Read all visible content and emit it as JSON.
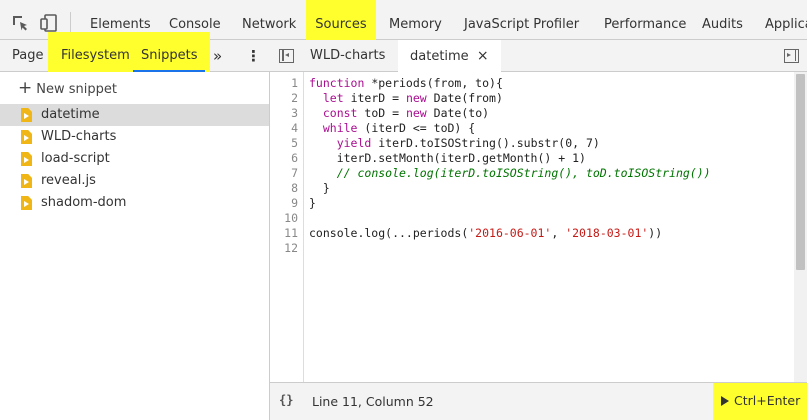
{
  "top_tabs": [
    {
      "label": "Elements"
    },
    {
      "label": "Console"
    },
    {
      "label": "Network"
    },
    {
      "label": "Sources"
    },
    {
      "label": "Memory"
    },
    {
      "label": "JavaScript Profiler"
    },
    {
      "label": "Performance"
    },
    {
      "label": "Audits"
    },
    {
      "label": "Applica"
    }
  ],
  "nav": {
    "tabs": [
      {
        "label": "Page"
      },
      {
        "label": "Filesystem"
      },
      {
        "label": "Snippets"
      }
    ],
    "more_glyph": "»",
    "menu_glyph": "⋮",
    "new_snippet_label": "New snippet",
    "files": [
      {
        "name": "datetime",
        "selected": true
      },
      {
        "name": "WLD-charts"
      },
      {
        "name": "load-script"
      },
      {
        "name": "reveal.js"
      },
      {
        "name": "shadom-dom"
      }
    ]
  },
  "editor": {
    "tabs": [
      {
        "label": "WLD-charts"
      },
      {
        "label": "datetime",
        "close_glyph": "×"
      }
    ],
    "line_numbers": [
      "1",
      "2",
      "3",
      "4",
      "5",
      "6",
      "7",
      "8",
      "9",
      "10",
      "11",
      "12"
    ],
    "code_lines": [
      "function *periods(from, to){",
      "  let iterD = new Date(from)",
      "  const toD = new Date(to)",
      "  while (iterD <= toD) {",
      "    yield iterD.toISOString().substr(0, 7)",
      "    iterD.setMonth(iterD.getMonth() + 1)",
      "    // console.log(iterD.toISOString(), toD.toISOString())",
      "  }",
      "}",
      "",
      "console.log(...periods('2016-06-01', '2018-03-01'))",
      ""
    ]
  },
  "status": {
    "braces": "{}",
    "cursor": "Line 11, Column 52",
    "run_label": "Ctrl+Enter"
  },
  "colors": {
    "highlight": "#ffff2e",
    "keyword": "#aa0d91",
    "string": "#c41a16",
    "comment": "#007400",
    "snippet_icon": "#f0b616"
  },
  "icons": [
    "inspect-element-icon",
    "device-toolbar-icon",
    "toggle-navigator-icon",
    "toggle-debugger-icon",
    "snippet-file-icon",
    "play-icon"
  ]
}
